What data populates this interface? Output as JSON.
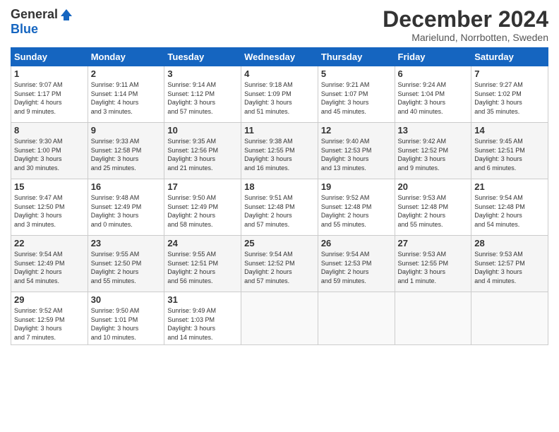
{
  "header": {
    "logo_general": "General",
    "logo_blue": "Blue",
    "title": "December 2024",
    "subtitle": "Marielund, Norrbotten, Sweden"
  },
  "days_of_week": [
    "Sunday",
    "Monday",
    "Tuesday",
    "Wednesday",
    "Thursday",
    "Friday",
    "Saturday"
  ],
  "weeks": [
    [
      {
        "day": "1",
        "info": "Sunrise: 9:07 AM\nSunset: 1:17 PM\nDaylight: 4 hours\nand 9 minutes."
      },
      {
        "day": "2",
        "info": "Sunrise: 9:11 AM\nSunset: 1:14 PM\nDaylight: 4 hours\nand 3 minutes."
      },
      {
        "day": "3",
        "info": "Sunrise: 9:14 AM\nSunset: 1:12 PM\nDaylight: 3 hours\nand 57 minutes."
      },
      {
        "day": "4",
        "info": "Sunrise: 9:18 AM\nSunset: 1:09 PM\nDaylight: 3 hours\nand 51 minutes."
      },
      {
        "day": "5",
        "info": "Sunrise: 9:21 AM\nSunset: 1:07 PM\nDaylight: 3 hours\nand 45 minutes."
      },
      {
        "day": "6",
        "info": "Sunrise: 9:24 AM\nSunset: 1:04 PM\nDaylight: 3 hours\nand 40 minutes."
      },
      {
        "day": "7",
        "info": "Sunrise: 9:27 AM\nSunset: 1:02 PM\nDaylight: 3 hours\nand 35 minutes."
      }
    ],
    [
      {
        "day": "8",
        "info": "Sunrise: 9:30 AM\nSunset: 1:00 PM\nDaylight: 3 hours\nand 30 minutes."
      },
      {
        "day": "9",
        "info": "Sunrise: 9:33 AM\nSunset: 12:58 PM\nDaylight: 3 hours\nand 25 minutes."
      },
      {
        "day": "10",
        "info": "Sunrise: 9:35 AM\nSunset: 12:56 PM\nDaylight: 3 hours\nand 21 minutes."
      },
      {
        "day": "11",
        "info": "Sunrise: 9:38 AM\nSunset: 12:55 PM\nDaylight: 3 hours\nand 16 minutes."
      },
      {
        "day": "12",
        "info": "Sunrise: 9:40 AM\nSunset: 12:53 PM\nDaylight: 3 hours\nand 13 minutes."
      },
      {
        "day": "13",
        "info": "Sunrise: 9:42 AM\nSunset: 12:52 PM\nDaylight: 3 hours\nand 9 minutes."
      },
      {
        "day": "14",
        "info": "Sunrise: 9:45 AM\nSunset: 12:51 PM\nDaylight: 3 hours\nand 6 minutes."
      }
    ],
    [
      {
        "day": "15",
        "info": "Sunrise: 9:47 AM\nSunset: 12:50 PM\nDaylight: 3 hours\nand 3 minutes."
      },
      {
        "day": "16",
        "info": "Sunrise: 9:48 AM\nSunset: 12:49 PM\nDaylight: 3 hours\nand 0 minutes."
      },
      {
        "day": "17",
        "info": "Sunrise: 9:50 AM\nSunset: 12:49 PM\nDaylight: 2 hours\nand 58 minutes."
      },
      {
        "day": "18",
        "info": "Sunrise: 9:51 AM\nSunset: 12:48 PM\nDaylight: 2 hours\nand 57 minutes."
      },
      {
        "day": "19",
        "info": "Sunrise: 9:52 AM\nSunset: 12:48 PM\nDaylight: 2 hours\nand 55 minutes."
      },
      {
        "day": "20",
        "info": "Sunrise: 9:53 AM\nSunset: 12:48 PM\nDaylight: 2 hours\nand 55 minutes."
      },
      {
        "day": "21",
        "info": "Sunrise: 9:54 AM\nSunset: 12:48 PM\nDaylight: 2 hours\nand 54 minutes."
      }
    ],
    [
      {
        "day": "22",
        "info": "Sunrise: 9:54 AM\nSunset: 12:49 PM\nDaylight: 2 hours\nand 54 minutes."
      },
      {
        "day": "23",
        "info": "Sunrise: 9:55 AM\nSunset: 12:50 PM\nDaylight: 2 hours\nand 55 minutes."
      },
      {
        "day": "24",
        "info": "Sunrise: 9:55 AM\nSunset: 12:51 PM\nDaylight: 2 hours\nand 56 minutes."
      },
      {
        "day": "25",
        "info": "Sunrise: 9:54 AM\nSunset: 12:52 PM\nDaylight: 2 hours\nand 57 minutes."
      },
      {
        "day": "26",
        "info": "Sunrise: 9:54 AM\nSunset: 12:53 PM\nDaylight: 2 hours\nand 59 minutes."
      },
      {
        "day": "27",
        "info": "Sunrise: 9:53 AM\nSunset: 12:55 PM\nDaylight: 3 hours\nand 1 minute."
      },
      {
        "day": "28",
        "info": "Sunrise: 9:53 AM\nSunset: 12:57 PM\nDaylight: 3 hours\nand 4 minutes."
      }
    ],
    [
      {
        "day": "29",
        "info": "Sunrise: 9:52 AM\nSunset: 12:59 PM\nDaylight: 3 hours\nand 7 minutes."
      },
      {
        "day": "30",
        "info": "Sunrise: 9:50 AM\nSunset: 1:01 PM\nDaylight: 3 hours\nand 10 minutes."
      },
      {
        "day": "31",
        "info": "Sunrise: 9:49 AM\nSunset: 1:03 PM\nDaylight: 3 hours\nand 14 minutes."
      },
      {
        "day": "",
        "info": ""
      },
      {
        "day": "",
        "info": ""
      },
      {
        "day": "",
        "info": ""
      },
      {
        "day": "",
        "info": ""
      }
    ]
  ]
}
